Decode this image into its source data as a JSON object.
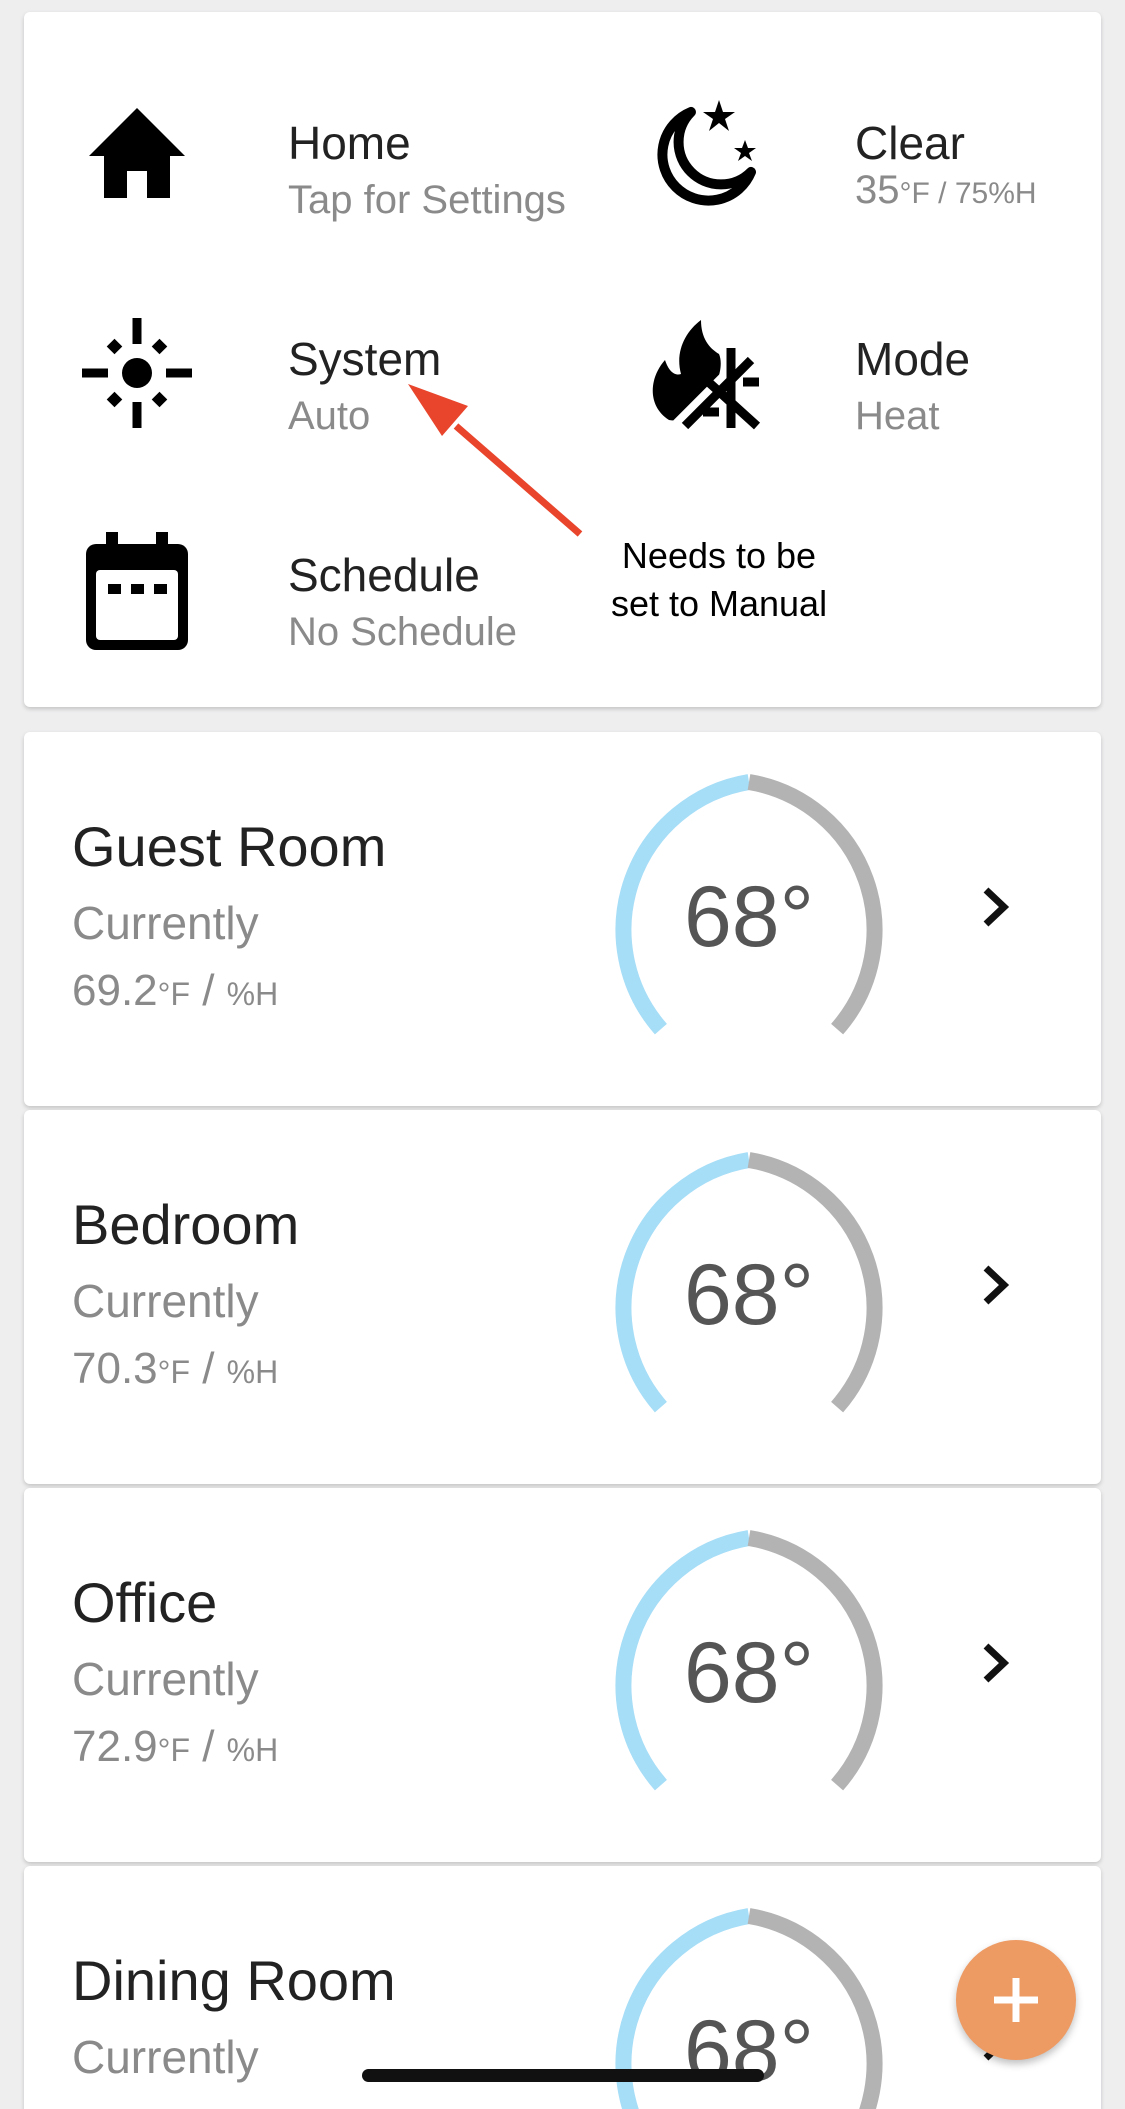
{
  "status_tiles": [
    {
      "title": "Home",
      "subtitle": "Tap for Settings",
      "icon": "home-icon"
    },
    {
      "title": "Clear",
      "subtitle_main": "35",
      "subtitle_unit": "°F / 75",
      "subtitle_unit2": "%H",
      "icon": "moon-stars-icon"
    },
    {
      "title": "System",
      "subtitle": "Auto",
      "icon": "sun-icon"
    },
    {
      "title": "Mode",
      "subtitle": "Heat",
      "icon": "heat-cool-icon"
    },
    {
      "title": "Schedule",
      "subtitle": "No Schedule",
      "icon": "calendar-icon"
    }
  ],
  "annotation": {
    "line1": "Needs to be",
    "line2": "set to Manual",
    "arrow_color": "#e8452c"
  },
  "rooms": [
    {
      "name": "Guest Room",
      "currently": "Currently",
      "temp": "69.2",
      "unit": "°F",
      "sep": " / ",
      "humidity": "%H",
      "setpoint": "68°"
    },
    {
      "name": "Bedroom",
      "currently": "Currently",
      "temp": "70.3",
      "unit": "°F",
      "sep": " / ",
      "humidity": "%H",
      "setpoint": "68°"
    },
    {
      "name": "Office",
      "currently": "Currently",
      "temp": "72.9",
      "unit": "°F",
      "sep": " / ",
      "humidity": "%H",
      "setpoint": "68°"
    },
    {
      "name": "Dining Room",
      "currently": "Currently",
      "temp": "",
      "unit": "",
      "sep": "",
      "humidity": "",
      "setpoint": "68°"
    }
  ],
  "colors": {
    "dial_heat": "#a6ddf7",
    "dial_track": "#b3b3b3",
    "fab": "#ee9a63"
  },
  "fab": {
    "icon": "plus-icon"
  }
}
